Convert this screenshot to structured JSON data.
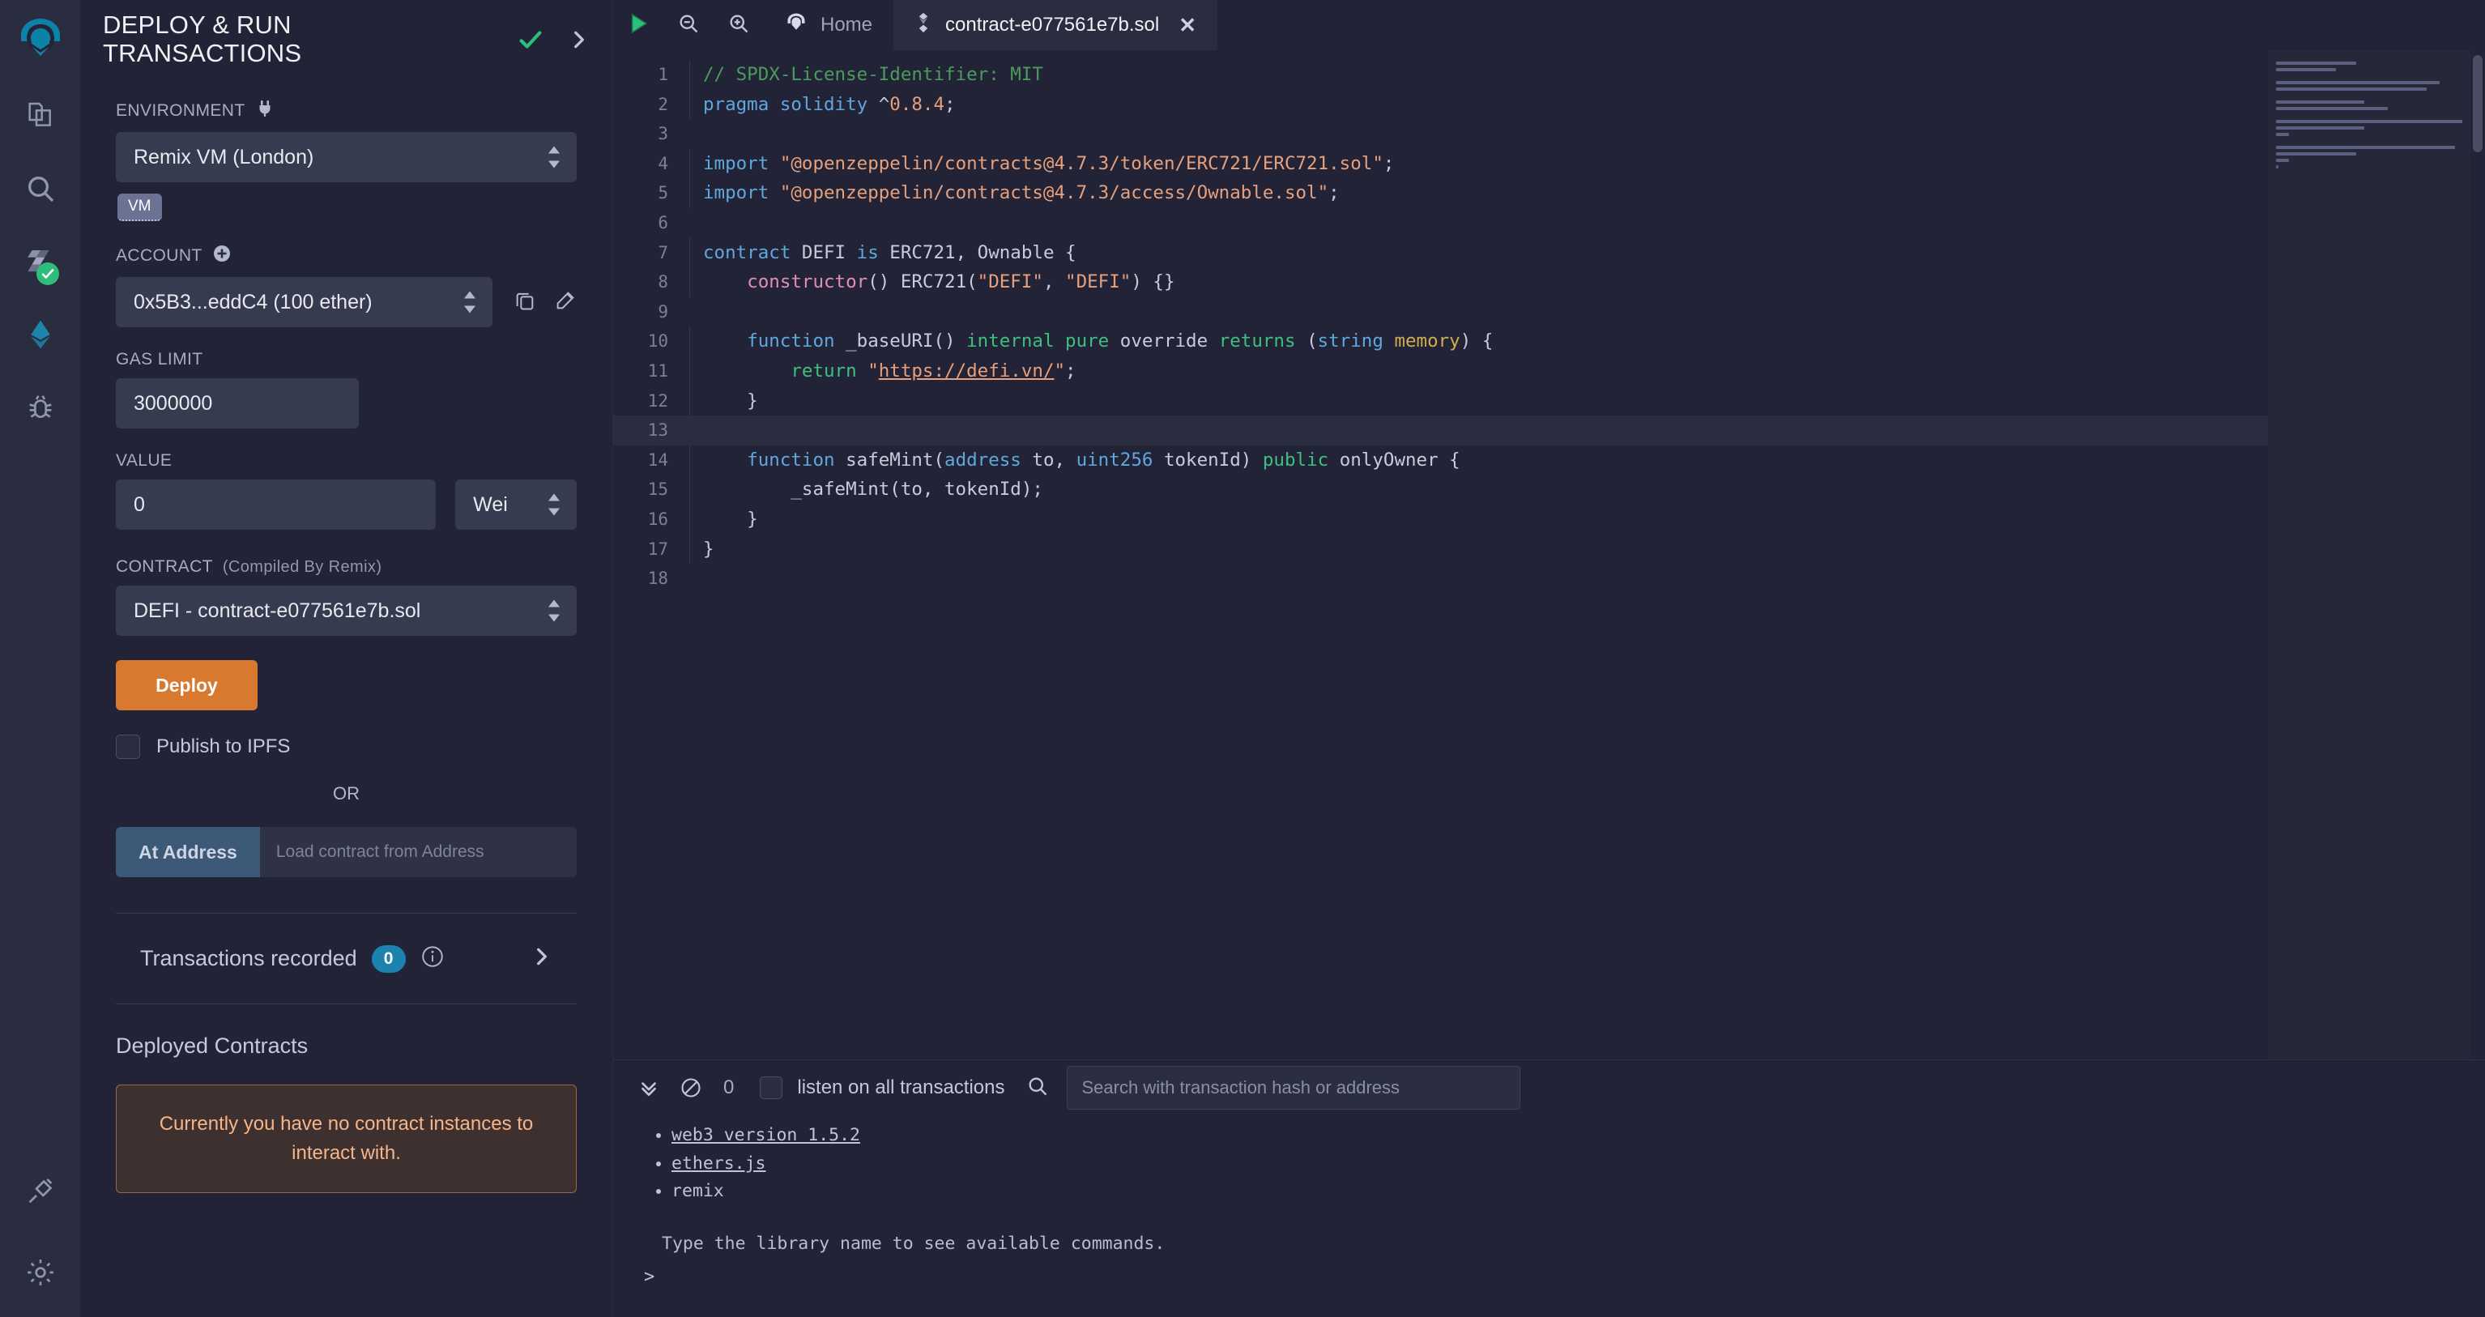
{
  "iconbar": {
    "items": [
      {
        "name": "remix-logo",
        "label": "Remix"
      },
      {
        "name": "file-explorer",
        "label": "File explorer"
      },
      {
        "name": "search",
        "label": "Search in files"
      },
      {
        "name": "solidity-compiler",
        "label": "Solidity compiler"
      },
      {
        "name": "deploy-run",
        "label": "Deploy & run transactions"
      },
      {
        "name": "debugger",
        "label": "Debugger"
      },
      {
        "name": "plugin-manager",
        "label": "Plugin manager"
      },
      {
        "name": "settings",
        "label": "Settings"
      }
    ]
  },
  "panel": {
    "title": "DEPLOY & RUN TRANSACTIONS",
    "environment": {
      "label": "ENVIRONMENT",
      "value": "Remix VM (London)",
      "badge": "VM"
    },
    "account": {
      "label": "ACCOUNT",
      "value": "0x5B3...eddC4 (100 ether)"
    },
    "gas_limit": {
      "label": "GAS LIMIT",
      "value": "3000000"
    },
    "value_field": {
      "label": "VALUE",
      "value": "0",
      "unit": "Wei"
    },
    "contract": {
      "label": "CONTRACT",
      "sublabel": "(Compiled By Remix)",
      "value": "DEFI - contract-e077561e7b.sol"
    },
    "deploy_label": "Deploy",
    "publish_ipfs_label": "Publish to IPFS",
    "or_label": "OR",
    "at_address_label": "At Address",
    "at_address_placeholder": "Load contract from Address",
    "transactions_recorded": {
      "label": "Transactions recorded",
      "count": "0"
    },
    "deployed_contracts": {
      "title": "Deployed Contracts",
      "empty_message": "Currently you have no contract instances to interact with."
    }
  },
  "editor": {
    "tabs": [
      {
        "label": "Home",
        "icon": "remix-logo-icon",
        "active": false,
        "closable": false
      },
      {
        "label": "contract-e077561e7b.sol",
        "icon": "solidity-icon",
        "active": true,
        "closable": true
      }
    ],
    "toolbar": [
      {
        "name": "run-script-icon",
        "label": "Run"
      },
      {
        "name": "zoom-out-icon",
        "label": "Zoom out"
      },
      {
        "name": "zoom-in-icon",
        "label": "Zoom in"
      }
    ],
    "current_line": 13,
    "lines": [
      {
        "n": 1,
        "tokens": [
          {
            "t": "// SPDX-License-Identifier: MIT",
            "c": "c-com"
          }
        ]
      },
      {
        "n": 2,
        "tokens": [
          {
            "t": "pragma",
            "c": "c-kw"
          },
          {
            "t": " ",
            "c": "c-def"
          },
          {
            "t": "solidity",
            "c": "c-kw"
          },
          {
            "t": " ^",
            "c": "c-def"
          },
          {
            "t": "0.8.4",
            "c": "c-num"
          },
          {
            "t": ";",
            "c": "c-def"
          }
        ]
      },
      {
        "n": 3,
        "tokens": []
      },
      {
        "n": 4,
        "tokens": [
          {
            "t": "import",
            "c": "c-kw"
          },
          {
            "t": " ",
            "c": "c-def"
          },
          {
            "t": "\"@openzeppelin/contracts@4.7.3/token/ERC721/ERC721.sol\"",
            "c": "c-str"
          },
          {
            "t": ";",
            "c": "c-def"
          }
        ]
      },
      {
        "n": 5,
        "tokens": [
          {
            "t": "import",
            "c": "c-kw"
          },
          {
            "t": " ",
            "c": "c-def"
          },
          {
            "t": "\"@openzeppelin/contracts@4.7.3/access/Ownable.sol\"",
            "c": "c-str"
          },
          {
            "t": ";",
            "c": "c-def"
          }
        ]
      },
      {
        "n": 6,
        "tokens": []
      },
      {
        "n": 7,
        "tokens": [
          {
            "t": "contract",
            "c": "c-kw"
          },
          {
            "t": " DEFI ",
            "c": "c-def"
          },
          {
            "t": "is",
            "c": "c-kw"
          },
          {
            "t": " ERC721, Ownable {",
            "c": "c-def"
          }
        ]
      },
      {
        "n": 8,
        "tokens": [
          {
            "t": "    ",
            "c": "c-def"
          },
          {
            "t": "constructor",
            "c": "c-pink"
          },
          {
            "t": "() ERC721(",
            "c": "c-def"
          },
          {
            "t": "\"DEFI\"",
            "c": "c-str"
          },
          {
            "t": ", ",
            "c": "c-def"
          },
          {
            "t": "\"DEFI\"",
            "c": "c-str"
          },
          {
            "t": ") {}",
            "c": "c-def"
          }
        ]
      },
      {
        "n": 9,
        "tokens": []
      },
      {
        "n": 10,
        "tokens": [
          {
            "t": "    ",
            "c": "c-def"
          },
          {
            "t": "function",
            "c": "c-kw"
          },
          {
            "t": " _baseURI() ",
            "c": "c-def"
          },
          {
            "t": "internal",
            "c": "c-grn"
          },
          {
            "t": " ",
            "c": "c-def"
          },
          {
            "t": "pure",
            "c": "c-grn"
          },
          {
            "t": " override ",
            "c": "c-def"
          },
          {
            "t": "returns",
            "c": "c-grn"
          },
          {
            "t": " (",
            "c": "c-def"
          },
          {
            "t": "string",
            "c": "c-typ"
          },
          {
            "t": " ",
            "c": "c-def"
          },
          {
            "t": "memory",
            "c": "c-yel"
          },
          {
            "t": ") {",
            "c": "c-def"
          }
        ]
      },
      {
        "n": 11,
        "tokens": [
          {
            "t": "        ",
            "c": "c-def"
          },
          {
            "t": "return",
            "c": "c-grn"
          },
          {
            "t": " ",
            "c": "c-def"
          },
          {
            "t": "\"",
            "c": "c-str"
          },
          {
            "t": "https://defi.vn/",
            "c": "c-url"
          },
          {
            "t": "\"",
            "c": "c-str"
          },
          {
            "t": ";",
            "c": "c-def"
          }
        ]
      },
      {
        "n": 12,
        "tokens": [
          {
            "t": "    }",
            "c": "c-def"
          }
        ]
      },
      {
        "n": 13,
        "tokens": []
      },
      {
        "n": 14,
        "tokens": [
          {
            "t": "    ",
            "c": "c-def"
          },
          {
            "t": "function",
            "c": "c-kw"
          },
          {
            "t": " safeMint(",
            "c": "c-def"
          },
          {
            "t": "address",
            "c": "c-typ"
          },
          {
            "t": " to, ",
            "c": "c-def"
          },
          {
            "t": "uint256",
            "c": "c-typ"
          },
          {
            "t": " tokenId) ",
            "c": "c-def"
          },
          {
            "t": "public",
            "c": "c-grn"
          },
          {
            "t": " onlyOwner {",
            "c": "c-def"
          }
        ]
      },
      {
        "n": 15,
        "tokens": [
          {
            "t": "        _safeMint(to, tokenId);",
            "c": "c-def"
          }
        ]
      },
      {
        "n": 16,
        "tokens": [
          {
            "t": "    }",
            "c": "c-def"
          }
        ]
      },
      {
        "n": 17,
        "tokens": [
          {
            "t": "}",
            "c": "c-def"
          }
        ]
      },
      {
        "n": 18,
        "tokens": []
      }
    ]
  },
  "terminal": {
    "count": "0",
    "listen_label": "listen on all transactions",
    "search_placeholder": "Search with transaction hash or address",
    "entries": [
      "web3 version 1.5.2",
      "ethers.js",
      "remix"
    ],
    "hint": "Type the library name to see available commands.",
    "prompt": ">"
  },
  "colors": {
    "accent_orange": "#d9792f",
    "accent_blue": "#1c82ae",
    "at_address_blue": "#3c5a78",
    "warning_bg": "#3e302e",
    "warning_text": "#f5b58a",
    "panel_bg": "#222336",
    "iconbar_bg": "#2a2c3f",
    "input_bg": "#373b50"
  }
}
